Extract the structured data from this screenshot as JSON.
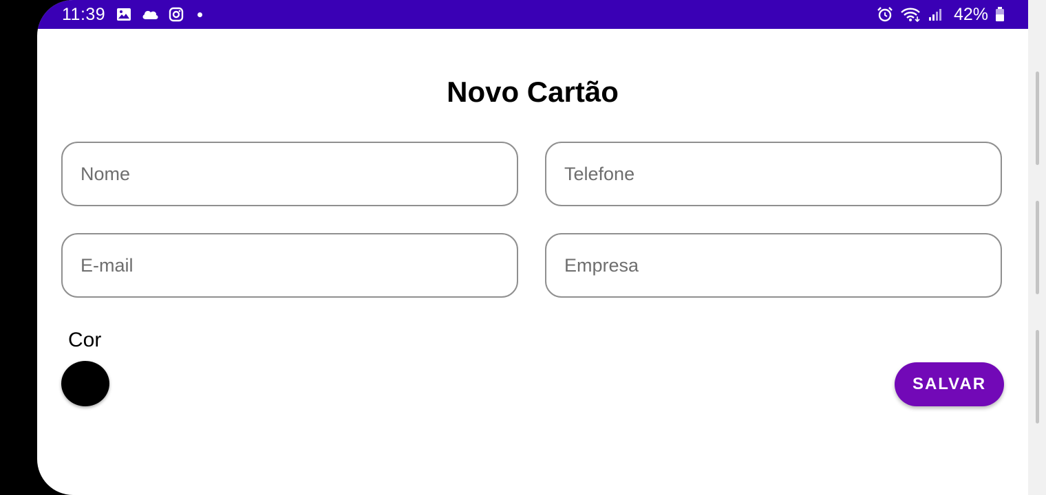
{
  "status_bar": {
    "time": "11:39",
    "left_icons": [
      "gallery-icon",
      "cloud-icon",
      "instagram-icon",
      "notification-dot-icon"
    ],
    "right_icons": [
      "alarm-icon",
      "wifi-icon",
      "signal-icon",
      "battery-icon"
    ],
    "battery_percent": "42%",
    "background_color": "#3a00b5"
  },
  "form": {
    "title": "Novo Cartão",
    "fields": {
      "nome": {
        "placeholder": "Nome",
        "value": ""
      },
      "telefone": {
        "placeholder": "Telefone",
        "value": ""
      },
      "email": {
        "placeholder": "E-mail",
        "value": ""
      },
      "empresa": {
        "placeholder": "Empresa",
        "value": ""
      }
    },
    "color_label": "Cor",
    "selected_color": "#000000",
    "save_label": "SALVAR",
    "save_button_color": "#7209b7"
  }
}
